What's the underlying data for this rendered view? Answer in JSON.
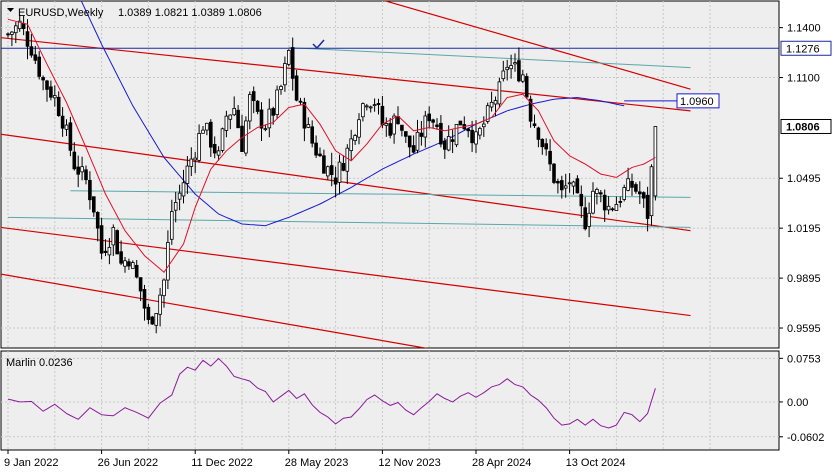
{
  "header": {
    "symbol_timeframe": "EURUSD,Weekly",
    "ohlc": "1.0389 1.0821 1.0389 1.0806"
  },
  "indicator": {
    "name_value": "Marlin 0.0236"
  },
  "price_labels": {
    "resistance": "1.1276",
    "ma_value": "1.0960",
    "current": "1.0806"
  },
  "colors": {
    "background": "#ffffff",
    "plot_bg": "#eeeeee",
    "grid": "#c8c8c8",
    "candle": "#000000",
    "channel": "#d40000",
    "fast_ma": "#e0102a",
    "slow_ma": "#1a1ad0",
    "hline": "#1a2aa0",
    "cyan_lines": "#5aa8a8",
    "oscillator": "#8b1a9b",
    "label_fill_current": "#ffffff",
    "label_fill_blue": "#ffffff"
  },
  "chart_data": {
    "type": "candlestick",
    "title": "EURUSD,Weekly",
    "price_axis": {
      "ticks": [
        "1.1400",
        "1.1100",
        "1.0495",
        "1.0195",
        "0.9895",
        "0.9595"
      ],
      "tick_values": [
        1.14,
        1.11,
        1.0495,
        1.0195,
        0.9895,
        0.9595
      ],
      "range": [
        0.9475,
        1.156
      ]
    },
    "indicator_axis": {
      "ticks": [
        "0.0753",
        "0.00",
        "-0.0602"
      ],
      "tick_values": [
        0.0753,
        0.0,
        -0.0602
      ],
      "range": [
        -0.083,
        0.088
      ]
    },
    "time_axis": {
      "labels": [
        "9 Jan 2022",
        "26 Jun 2022",
        "11 Dec 2022",
        "28 May 2023",
        "12 Nov 2023",
        "28 Apr 2024",
        "13 Oct 2024"
      ],
      "label_bar_index": [
        0,
        24,
        48,
        72,
        96,
        120,
        144
      ]
    },
    "horizontal_line": 1.1276,
    "bar_count": 167,
    "close_waypoints": [
      [
        0,
        1.136
      ],
      [
        3,
        1.142
      ],
      [
        6,
        1.128
      ],
      [
        9,
        1.108
      ],
      [
        12,
        1.098
      ],
      [
        14,
        1.085
      ],
      [
        17,
        1.058
      ],
      [
        20,
        1.048
      ],
      [
        22,
        1.032
      ],
      [
        24,
        1.005
      ],
      [
        27,
        1.018
      ],
      [
        29,
        0.998
      ],
      [
        31,
        1.002
      ],
      [
        34,
        0.982
      ],
      [
        36,
        0.962
      ],
      [
        38,
        0.972
      ],
      [
        40,
        0.988
      ],
      [
        42,
        1.03
      ],
      [
        44,
        1.04
      ],
      [
        46,
        1.055
      ],
      [
        48,
        1.067
      ],
      [
        50,
        1.082
      ],
      [
        52,
        1.072
      ],
      [
        54,
        1.062
      ],
      [
        56,
        1.087
      ],
      [
        58,
        1.092
      ],
      [
        60,
        1.07
      ],
      [
        62,
        1.097
      ],
      [
        64,
        1.086
      ],
      [
        66,
        1.082
      ],
      [
        68,
        1.09
      ],
      [
        70,
        1.104
      ],
      [
        72,
        1.125
      ],
      [
        74,
        1.097
      ],
      [
        76,
        1.085
      ],
      [
        78,
        1.071
      ],
      [
        80,
        1.062
      ],
      [
        82,
        1.055
      ],
      [
        84,
        1.05
      ],
      [
        86,
        1.06
      ],
      [
        88,
        1.072
      ],
      [
        90,
        1.09
      ],
      [
        92,
        1.098
      ],
      [
        94,
        1.096
      ],
      [
        96,
        1.082
      ],
      [
        98,
        1.08
      ],
      [
        100,
        1.087
      ],
      [
        102,
        1.072
      ],
      [
        104,
        1.066
      ],
      [
        106,
        1.077
      ],
      [
        108,
        1.088
      ],
      [
        110,
        1.082
      ],
      [
        112,
        1.07
      ],
      [
        114,
        1.076
      ],
      [
        116,
        1.084
      ],
      [
        118,
        1.081
      ],
      [
        120,
        1.072
      ],
      [
        122,
        1.082
      ],
      [
        124,
        1.093
      ],
      [
        126,
        1.102
      ],
      [
        128,
        1.118
      ],
      [
        130,
        1.115
      ],
      [
        132,
        1.112
      ],
      [
        134,
        1.088
      ],
      [
        136,
        1.078
      ],
      [
        138,
        1.063
      ],
      [
        140,
        1.05
      ],
      [
        142,
        1.04
      ],
      [
        144,
        1.048
      ],
      [
        146,
        1.035
      ],
      [
        148,
        1.024
      ],
      [
        150,
        1.042
      ],
      [
        152,
        1.038
      ],
      [
        154,
        1.032
      ],
      [
        156,
        1.035
      ],
      [
        158,
        1.042
      ],
      [
        160,
        1.045
      ],
      [
        162,
        1.04
      ],
      [
        164,
        1.028
      ],
      [
        166,
        1.0806
      ]
    ],
    "fast_ma_waypoints": [
      [
        0,
        1.145
      ],
      [
        5,
        1.142
      ],
      [
        10,
        1.118
      ],
      [
        15,
        1.095
      ],
      [
        20,
        1.068
      ],
      [
        25,
        1.04
      ],
      [
        30,
        1.018
      ],
      [
        35,
        1.003
      ],
      [
        40,
        0.993
      ],
      [
        45,
        1.01
      ],
      [
        48,
        1.032
      ],
      [
        52,
        1.055
      ],
      [
        56,
        1.066
      ],
      [
        60,
        1.074
      ],
      [
        64,
        1.08
      ],
      [
        68,
        1.083
      ],
      [
        72,
        1.092
      ],
      [
        76,
        1.094
      ],
      [
        80,
        1.082
      ],
      [
        84,
        1.066
      ],
      [
        88,
        1.06
      ],
      [
        92,
        1.07
      ],
      [
        96,
        1.082
      ],
      [
        100,
        1.087
      ],
      [
        104,
        1.078
      ],
      [
        108,
        1.08
      ],
      [
        112,
        1.078
      ],
      [
        116,
        1.08
      ],
      [
        120,
        1.082
      ],
      [
        124,
        1.086
      ],
      [
        128,
        1.098
      ],
      [
        132,
        1.1
      ],
      [
        136,
        1.09
      ],
      [
        140,
        1.072
      ],
      [
        144,
        1.063
      ],
      [
        148,
        1.058
      ],
      [
        152,
        1.052
      ],
      [
        156,
        1.05
      ],
      [
        160,
        1.056
      ],
      [
        163,
        1.058
      ],
      [
        166,
        1.062
      ]
    ],
    "slow_ma_waypoints": [
      [
        0,
        1.225
      ],
      [
        8,
        1.205
      ],
      [
        16,
        1.17
      ],
      [
        24,
        1.13
      ],
      [
        32,
        1.093
      ],
      [
        40,
        1.062
      ],
      [
        48,
        1.04
      ],
      [
        54,
        1.028
      ],
      [
        60,
        1.022
      ],
      [
        66,
        1.021
      ],
      [
        72,
        1.026
      ],
      [
        80,
        1.034
      ],
      [
        88,
        1.044
      ],
      [
        96,
        1.055
      ],
      [
        104,
        1.064
      ],
      [
        112,
        1.072
      ],
      [
        120,
        1.082
      ],
      [
        128,
        1.09
      ],
      [
        134,
        1.094
      ],
      [
        140,
        1.097
      ],
      [
        146,
        1.098
      ],
      [
        152,
        1.096
      ],
      [
        158,
        1.093
      ]
    ],
    "channel_lines": [
      [
        [
          -2,
          1.134
        ],
        [
          175,
          1.09
        ]
      ],
      [
        [
          -2,
          1.076
        ],
        [
          175,
          1.018
        ]
      ],
      [
        [
          -2,
          1.02
        ],
        [
          175,
          0.967
        ]
      ],
      [
        [
          -2,
          0.992
        ],
        [
          113,
          0.945
        ]
      ],
      [
        [
          88,
          1.162
        ],
        [
          175,
          1.103
        ]
      ]
    ],
    "cyan_lines": [
      [
        [
          72,
          1.128
        ],
        [
          175,
          1.116
        ]
      ],
      [
        [
          16,
          1.042
        ],
        [
          175,
          1.038
        ]
      ],
      [
        [
          0,
          1.026
        ],
        [
          175,
          1.02
        ]
      ]
    ],
    "oscillator_waypoints": [
      [
        0,
        0.005
      ],
      [
        3,
        0.0
      ],
      [
        6,
        0.001
      ],
      [
        9,
        -0.016
      ],
      [
        12,
        -0.004
      ],
      [
        15,
        -0.02
      ],
      [
        18,
        -0.03
      ],
      [
        21,
        -0.01
      ],
      [
        24,
        -0.022
      ],
      [
        27,
        -0.024
      ],
      [
        30,
        -0.01
      ],
      [
        33,
        -0.018
      ],
      [
        36,
        -0.028
      ],
      [
        39,
        -0.002
      ],
      [
        42,
        0.012
      ],
      [
        44,
        0.048
      ],
      [
        46,
        0.06
      ],
      [
        48,
        0.055
      ],
      [
        50,
        0.072
      ],
      [
        52,
        0.062
      ],
      [
        54,
        0.075
      ],
      [
        56,
        0.062
      ],
      [
        58,
        0.044
      ],
      [
        60,
        0.04
      ],
      [
        62,
        0.036
      ],
      [
        64,
        0.024
      ],
      [
        66,
        0.018
      ],
      [
        68,
        0.0
      ],
      [
        70,
        0.01
      ],
      [
        72,
        0.02
      ],
      [
        74,
        0.006
      ],
      [
        76,
        0.014
      ],
      [
        78,
        -0.005
      ],
      [
        80,
        -0.018
      ],
      [
        82,
        -0.026
      ],
      [
        84,
        -0.038
      ],
      [
        86,
        -0.028
      ],
      [
        88,
        -0.026
      ],
      [
        90,
        -0.012
      ],
      [
        92,
        0.004
      ],
      [
        94,
        0.012
      ],
      [
        96,
        0.002
      ],
      [
        98,
        -0.006
      ],
      [
        100,
        -0.001
      ],
      [
        102,
        -0.014
      ],
      [
        104,
        -0.022
      ],
      [
        106,
        -0.01
      ],
      [
        108,
        0.001
      ],
      [
        110,
        0.014
      ],
      [
        112,
        0.006
      ],
      [
        114,
        0.0
      ],
      [
        116,
        0.01
      ],
      [
        118,
        0.016
      ],
      [
        120,
        0.008
      ],
      [
        122,
        0.016
      ],
      [
        124,
        0.026
      ],
      [
        126,
        0.03
      ],
      [
        128,
        0.04
      ],
      [
        130,
        0.03
      ],
      [
        132,
        0.026
      ],
      [
        134,
        0.012
      ],
      [
        136,
        0.003
      ],
      [
        138,
        -0.01
      ],
      [
        140,
        -0.028
      ],
      [
        142,
        -0.04
      ],
      [
        144,
        -0.038
      ],
      [
        146,
        -0.03
      ],
      [
        148,
        -0.04
      ],
      [
        150,
        -0.03
      ],
      [
        152,
        -0.041
      ],
      [
        154,
        -0.045
      ],
      [
        156,
        -0.04
      ],
      [
        158,
        -0.018
      ],
      [
        160,
        -0.022
      ],
      [
        162,
        -0.034
      ],
      [
        164,
        -0.02
      ],
      [
        166,
        0.0236
      ]
    ]
  }
}
